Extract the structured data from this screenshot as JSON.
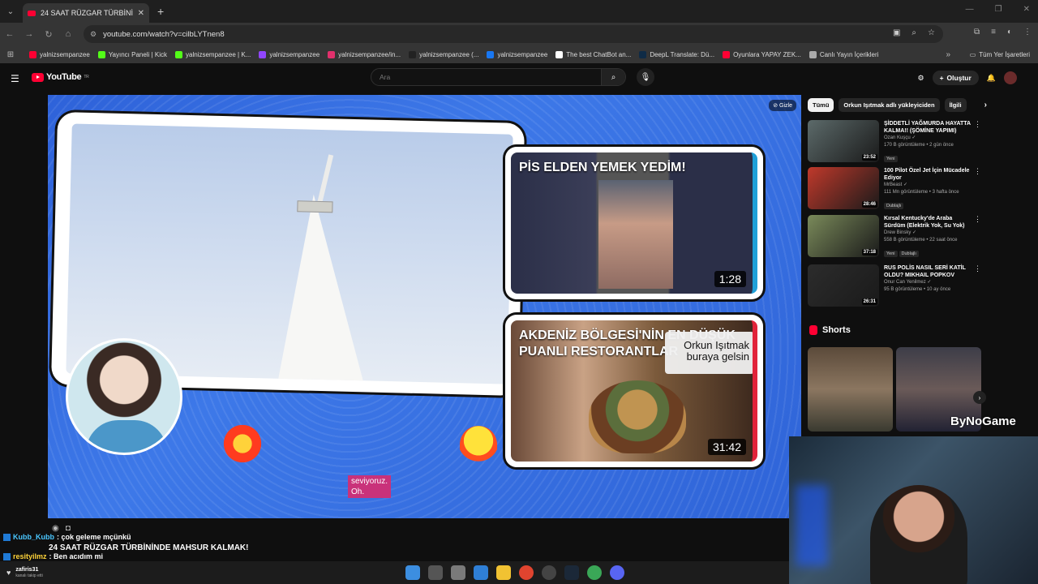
{
  "browser": {
    "tab_title": "24 SAAT RÜZGAR TÜRBİNİNDE",
    "url": "youtube.com/watch?v=cilbLYTnen8",
    "bookmarks": [
      {
        "label": "yalnizsempanzee",
        "color": "#ff0033"
      },
      {
        "label": "Yayıncı Paneli | Kick",
        "color": "#53fc18"
      },
      {
        "label": "yalnizsempanzee | K...",
        "color": "#53fc18"
      },
      {
        "label": "yalnizsempanzee",
        "color": "#9146ff"
      },
      {
        "label": "yalnizsempanzee/in...",
        "color": "#e1306c"
      },
      {
        "label": "yalnizsempanzee (...",
        "color": "#222222"
      },
      {
        "label": "yalnizsempanzee",
        "color": "#1877f2"
      },
      {
        "label": "The best ChatBot an...",
        "color": "#ffffff"
      },
      {
        "label": "DeepL Translate: Dü...",
        "color": "#0f2b46"
      },
      {
        "label": "Oyunlara YAPAY ZEK...",
        "color": "#ff0033"
      },
      {
        "label": "Canlı Yayın İçerikleri",
        "color": "#aaaaaa"
      }
    ],
    "all_bookmarks": "Tüm Yer İşaretleri"
  },
  "youtube": {
    "logo": "YouTube",
    "logo_sup": "TR",
    "search_placeholder": "Ara",
    "create_label": "Oluştur"
  },
  "player": {
    "hide_label": "Gizle",
    "card1": {
      "title": "PİS ELDEN YEMEK YEDİM!",
      "duration": "1:28"
    },
    "card2": {
      "title": "AKDENİZ BÖLGESİ'NİN EN DÜŞÜK PUANLI RESTORANTLAR",
      "duration": "31:42",
      "overlay": "Orkun Işıtmak buraya gelsin"
    },
    "caption_line1": "seviyoruz.",
    "caption_line2": "Oh."
  },
  "chips": [
    "Tümü",
    "Orkun Işıtmak adlı yükleyiciden",
    "İlgili"
  ],
  "recommendations": [
    {
      "title": "ŞİDDETLİ YAĞMURDA HAYATTA KALMA!! (ŞÖMİNE YAPIMI)",
      "channel": "Ozan Kuşçu ✓",
      "meta": "170 B görüntüleme • 2 gün önce",
      "badges": [
        "Yeni"
      ],
      "duration": "23:52",
      "thumb": "#5c6a6a"
    },
    {
      "title": "100 Pilot Özel Jet İçin Mücadele Ediyor",
      "channel": "MrBeast ✓",
      "meta": "111 Mn görüntüleme • 3 hafta önce",
      "badges": [
        "Dublajlı"
      ],
      "duration": "28:46",
      "thumb": "#c0392b"
    },
    {
      "title": "Kırsal Kentucky'de Araba Sürdüm (Elektrik Yok, Su Yok)",
      "channel": "Drew Binsky ✓",
      "meta": "558 B görüntüleme • 22 saat önce",
      "badges": [
        "Yeni",
        "Dublajlı"
      ],
      "duration": "37:18",
      "thumb": "#7a8a5a"
    },
    {
      "title": "RUS POLİS NASIL SERİ KATİL OLDU? MIKHAIL POPKOV",
      "channel": "Onur Can Yenilmez ✓",
      "meta": "95 B görüntüleme • 10 ay önce",
      "badges": [],
      "duration": "26:31",
      "thumb": "#2c2c2c"
    }
  ],
  "shorts": {
    "label": "Shorts"
  },
  "overlay": {
    "bynogame": "ByNoGame",
    "chat": [
      {
        "user": "Kubb_Kubb",
        "message": ": çok geleme mçünkü"
      },
      {
        "user": "resityilmz",
        "message": ": Ben acıdım mi"
      }
    ],
    "stream_title": "24 SAAT RÜZGAR TÜRBİNİNDE MAHSUR KALMAK!",
    "follower_name": "zafiris31",
    "follower_sub": "kanalı takip etti"
  }
}
